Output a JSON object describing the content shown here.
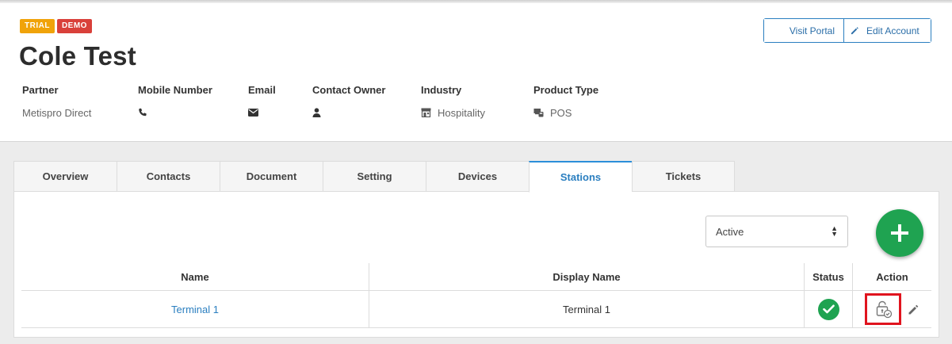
{
  "header": {
    "badges": {
      "trial": "TRIAL",
      "demo": "DEMO"
    },
    "account_name": "Cole Test",
    "buttons": {
      "visit_portal": "Visit Portal",
      "edit_account": "Edit Account"
    }
  },
  "fields": [
    {
      "label": "Partner",
      "value": "Metispro Direct",
      "icon": ""
    },
    {
      "label": "Mobile Number",
      "value": "",
      "icon": "phone-icon"
    },
    {
      "label": "Email",
      "value": "",
      "icon": "envelope-icon"
    },
    {
      "label": "Contact Owner",
      "value": "",
      "icon": "user-icon"
    },
    {
      "label": "Industry",
      "value": "Hospitality",
      "icon": "storefront-icon"
    },
    {
      "label": "Product Type",
      "value": "POS",
      "icon": "pos-terminal-icon"
    }
  ],
  "tabs": [
    {
      "label": "Overview",
      "active": false
    },
    {
      "label": "Contacts",
      "active": false
    },
    {
      "label": "Document",
      "active": false
    },
    {
      "label": "Setting",
      "active": false
    },
    {
      "label": "Devices",
      "active": false
    },
    {
      "label": "Stations",
      "active": true
    },
    {
      "label": "Tickets",
      "active": false
    }
  ],
  "filter": {
    "selected": "Active"
  },
  "table": {
    "columns": [
      "Name",
      "Display Name",
      "Status",
      "Action"
    ],
    "rows": [
      {
        "name": "Terminal 1",
        "display_name": "Terminal 1",
        "status": "active"
      }
    ]
  },
  "colors": {
    "accent": "#2b7fc0",
    "success": "#1fa351",
    "trial_badge": "#f0a30a",
    "demo_badge": "#d9403a",
    "highlight": "#e0141e"
  }
}
